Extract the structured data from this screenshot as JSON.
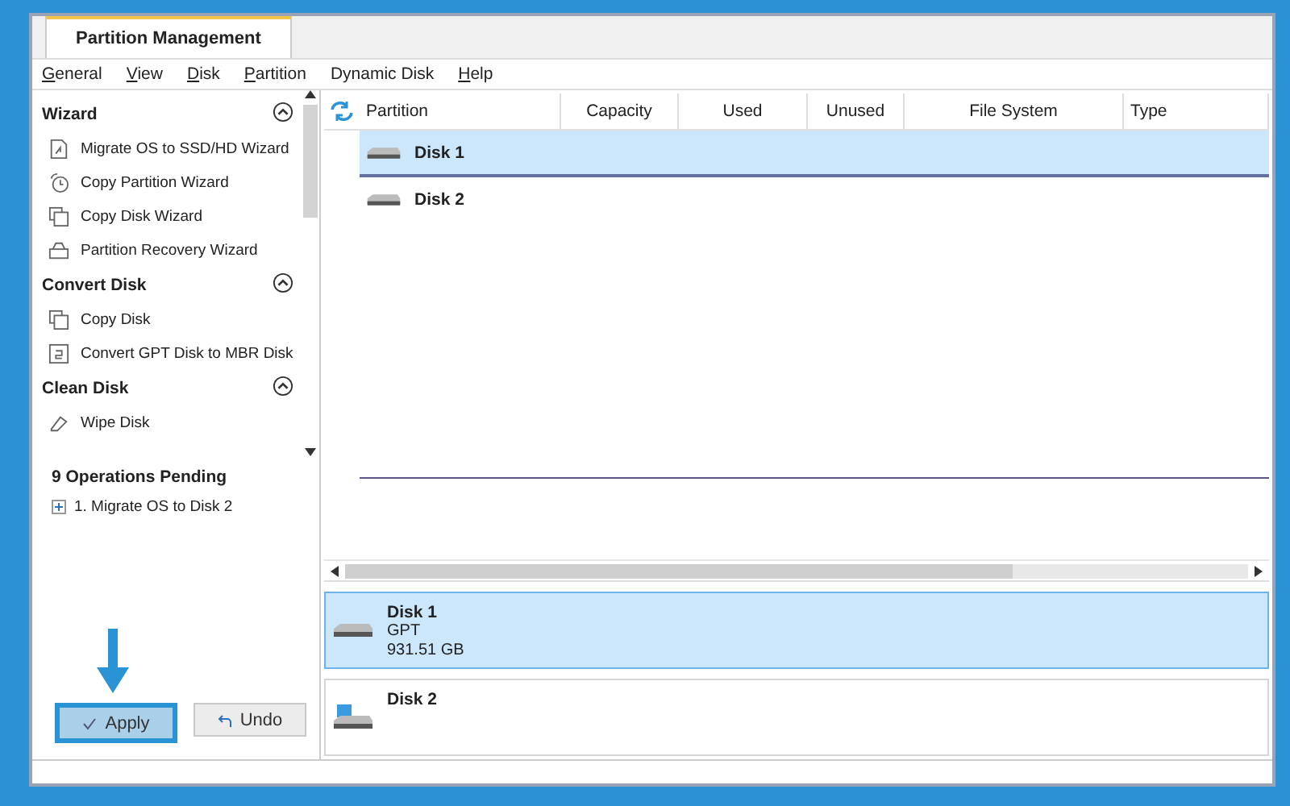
{
  "tabs": [
    {
      "label": "Partition Management",
      "selected": true
    }
  ],
  "menu": [
    {
      "label": "General",
      "accelerator": true
    },
    {
      "label": "View",
      "accelerator": true
    },
    {
      "label": "Disk",
      "accelerator": true
    },
    {
      "label": "Partition",
      "accelerator": true
    },
    {
      "label": "Dynamic Disk",
      "accelerator": false
    },
    {
      "label": "Help",
      "accelerator": true
    }
  ],
  "sidebar": {
    "sections": [
      {
        "title": "Wizard",
        "expanded": true,
        "items": [
          {
            "label": "Migrate OS to SSD/HD Wizard",
            "kind": "migrate"
          },
          {
            "label": "Copy Partition Wizard",
            "kind": "clock"
          },
          {
            "label": "Copy Disk Wizard",
            "kind": "copy"
          },
          {
            "label": "Partition Recovery Wizard",
            "kind": "recover"
          }
        ]
      },
      {
        "title": "Convert Disk",
        "expanded": true,
        "items": [
          {
            "label": "Copy Disk",
            "kind": "copy"
          },
          {
            "label": "Convert GPT Disk to MBR Disk",
            "kind": "convert"
          }
        ]
      },
      {
        "title": "Clean Disk",
        "expanded": true,
        "items": [
          {
            "label": "Wipe Disk",
            "kind": "eraser"
          }
        ]
      }
    ],
    "pending": {
      "title": "9 Operations Pending",
      "items": [
        {
          "label": "1. Migrate OS to Disk 2",
          "expanded": false
        }
      ]
    }
  },
  "buttons": [
    {
      "label": "Apply",
      "kind": "apply",
      "highlighted": true
    },
    {
      "label": "Undo",
      "kind": "undo",
      "highlighted": false
    }
  ],
  "table": {
    "columns": [
      "Partition",
      "Capacity",
      "Used",
      "Unused",
      "File System",
      "Type"
    ],
    "rows": [
      {
        "name": "Disk 1",
        "selected": true
      },
      {
        "name": "Disk 2",
        "selected": false
      }
    ]
  },
  "disk_map": [
    {
      "name": "Disk 1",
      "lines": [
        "GPT",
        "931.51 GB"
      ],
      "selected": true,
      "kind": "hdd"
    },
    {
      "name": "Disk 2",
      "selected": false,
      "kind": "usb"
    }
  ]
}
